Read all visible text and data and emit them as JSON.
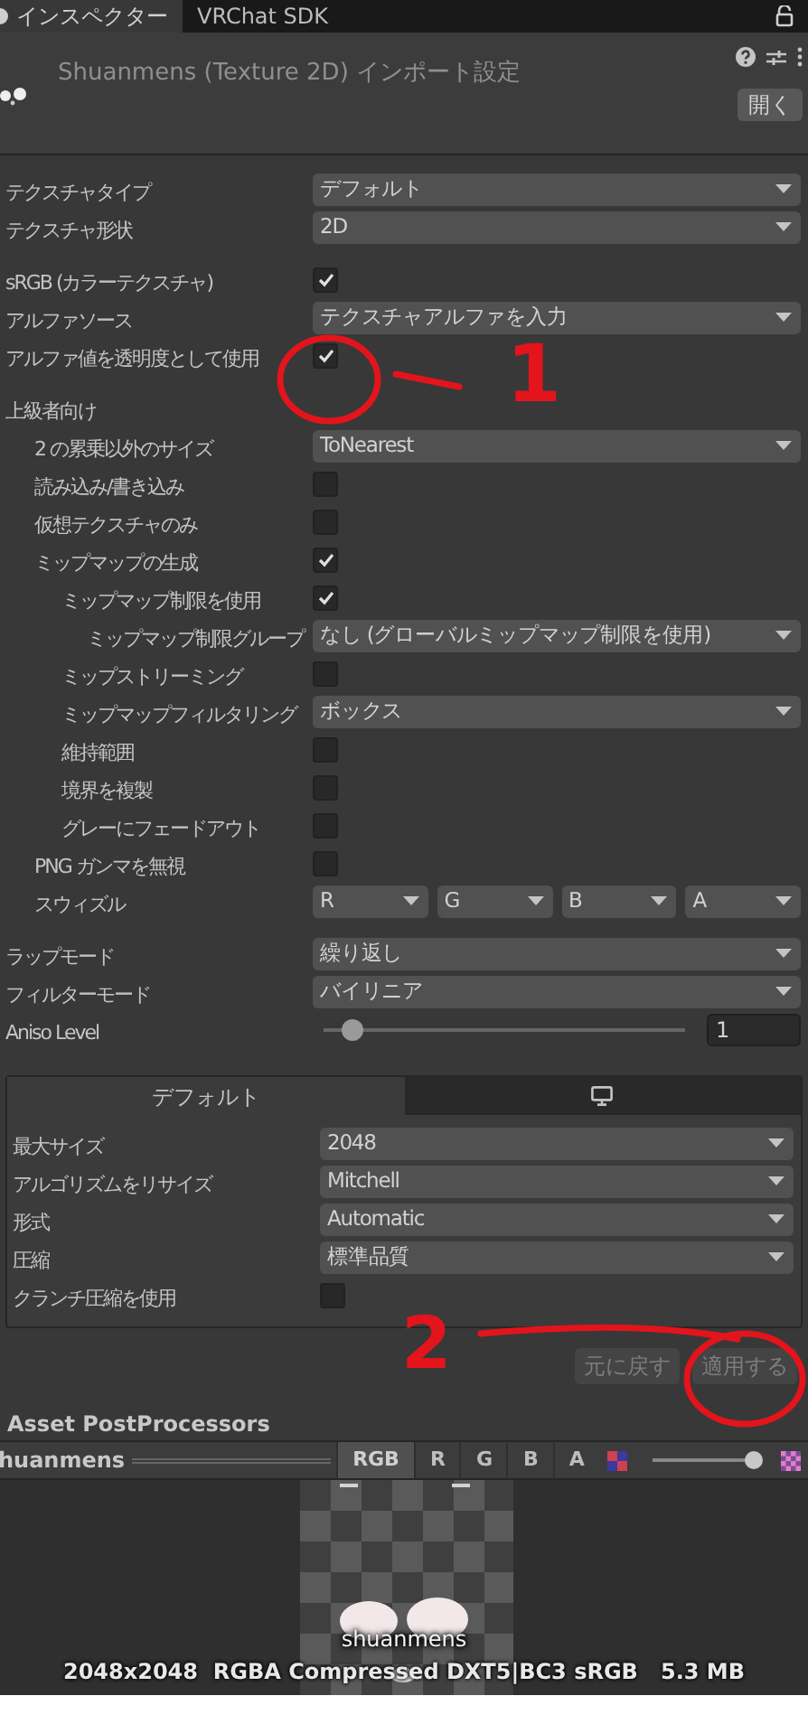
{
  "tabs": [
    {
      "label": "インスペクター",
      "selected": true
    },
    {
      "label": "VRChat SDK",
      "selected": false
    }
  ],
  "header": {
    "title": "Shuanmens (Texture 2D) インポート設定",
    "open_button": "開く"
  },
  "groups": [
    {
      "rows": [
        {
          "kind": "dropdown",
          "label": "テクスチャタイプ",
          "value": "デフォルト"
        },
        {
          "kind": "dropdown",
          "label": "テクスチャ形状",
          "value": "2D"
        }
      ]
    },
    {
      "rows": [
        {
          "kind": "checkbox",
          "label": "sRGB (カラーテクスチャ)",
          "checked": true
        },
        {
          "kind": "dropdown",
          "label": "アルファソース",
          "value": "テクスチャアルファを入力"
        },
        {
          "kind": "checkbox",
          "label": "アルファ値を透明度として使用",
          "checked": true
        }
      ]
    },
    {
      "rows": [
        {
          "kind": "section",
          "label": "上級者向け",
          "children": [
            {
              "kind": "dropdown",
              "label": "2 の累乗以外のサイズ",
              "value": "ToNearest"
            },
            {
              "kind": "checkbox",
              "label": "読み込み/書き込み",
              "checked": false
            },
            {
              "kind": "checkbox",
              "label": "仮想テクスチャのみ",
              "checked": false
            },
            {
              "kind": "checkbox",
              "label": "ミップマップの生成",
              "checked": true,
              "children": [
                {
                  "kind": "checkbox",
                  "label": "ミップマップ制限を使用",
                  "checked": true,
                  "children": [
                    {
                      "kind": "dropdown",
                      "label": "ミップマップ制限グループ",
                      "value": "なし (グローバルミップマップ制限を使用)"
                    }
                  ]
                },
                {
                  "kind": "checkbox",
                  "label": "ミップストリーミング",
                  "checked": false
                },
                {
                  "kind": "dropdown",
                  "label": "ミップマップフィルタリング",
                  "value": "ボックス"
                },
                {
                  "kind": "checkbox",
                  "label": "維持範囲",
                  "checked": false
                },
                {
                  "kind": "checkbox",
                  "label": "境界を複製",
                  "checked": false
                },
                {
                  "kind": "checkbox",
                  "label": "グレーにフェードアウト",
                  "checked": false
                }
              ]
            },
            {
              "kind": "checkbox",
              "label": "PNG ガンマを無視",
              "checked": false
            },
            {
              "kind": "swizzle",
              "label": "スウィズル",
              "values": [
                "R",
                "G",
                "B",
                "A"
              ]
            }
          ]
        }
      ]
    },
    {
      "rows": [
        {
          "kind": "dropdown",
          "label": "ラップモード",
          "value": "繰り返し"
        },
        {
          "kind": "dropdown",
          "label": "フィルターモード",
          "value": "バイリニア"
        },
        {
          "kind": "slider",
          "label": "Aniso Level",
          "level": 0.08,
          "value": "1"
        }
      ]
    }
  ],
  "platform": {
    "tabs": [
      {
        "kind": "text",
        "label": "デフォルト",
        "selected": true
      },
      {
        "kind": "monitor",
        "selected": false
      }
    ],
    "rows": [
      {
        "kind": "dropdown",
        "label": "最大サイズ",
        "value": "2048"
      },
      {
        "kind": "dropdown",
        "label": "アルゴリズムをリサイズ",
        "value": "Mitchell"
      },
      {
        "kind": "dropdown",
        "label": "形式",
        "value": "Automatic"
      },
      {
        "kind": "dropdown",
        "label": "圧縮",
        "value": "標準品質"
      },
      {
        "kind": "checkbox",
        "label": "クランチ圧縮を使用",
        "checked": false
      }
    ]
  },
  "buttons": [
    {
      "label": "元に戻す",
      "disabled": true
    },
    {
      "label": "適用する",
      "disabled": true
    }
  ],
  "post_processors": {
    "title": "Asset PostProcessors"
  },
  "preview": {
    "name": "huanmens",
    "channels": [
      {
        "label": "RGB",
        "selected": true
      },
      {
        "label": "R",
        "selected": false
      },
      {
        "label": "G",
        "selected": false
      },
      {
        "label": "B",
        "selected": false
      },
      {
        "label": "A",
        "selected": false
      }
    ],
    "mip": {
      "level": 1
    },
    "caption": "shuanmens",
    "info": "2048x2048  RGBA Compressed DXT5|BC3 sRGB   5.3 MB"
  },
  "annotations": [
    {
      "label": "1"
    },
    {
      "label": "2"
    }
  ]
}
